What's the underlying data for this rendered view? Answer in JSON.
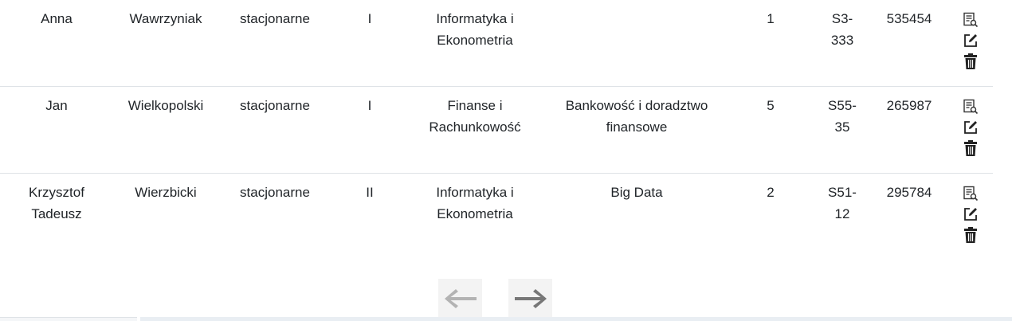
{
  "students": [
    {
      "first_name": "Anna",
      "last_name": "Wawrzyniak",
      "study_mode": "stacjonarne",
      "degree": "I",
      "field": "Informatyka i\nEkonometria",
      "specialization": "",
      "year": "1",
      "group": "S3-\n333",
      "index_number": "535454"
    },
    {
      "first_name": "Jan",
      "last_name": "Wielkopolski",
      "study_mode": "stacjonarne",
      "degree": "I",
      "field": "Finanse i\nRachunkowość",
      "specialization": "Bankowość i doradztwo\nfinansowe",
      "year": "5",
      "group": "S55-\n35",
      "index_number": "265987"
    },
    {
      "first_name": "Krzysztof\nTadeusz",
      "last_name": "Wierzbicki",
      "study_mode": "stacjonarne",
      "degree": "II",
      "field": "Informatyka i\nEkonometria",
      "specialization": "Big Data",
      "year": "2",
      "group": "S51-\n12",
      "index_number": "295784"
    }
  ],
  "icons": {
    "details": "details-icon",
    "edit": "edit-icon",
    "delete": "trash-icon",
    "prev": "arrow-left-icon",
    "next": "arrow-right-icon"
  },
  "colors": {
    "icon": "#333333",
    "prev_arrow": "#b3b3b3",
    "next_arrow": "#7a7a7a",
    "row_border": "#dee2e6"
  }
}
